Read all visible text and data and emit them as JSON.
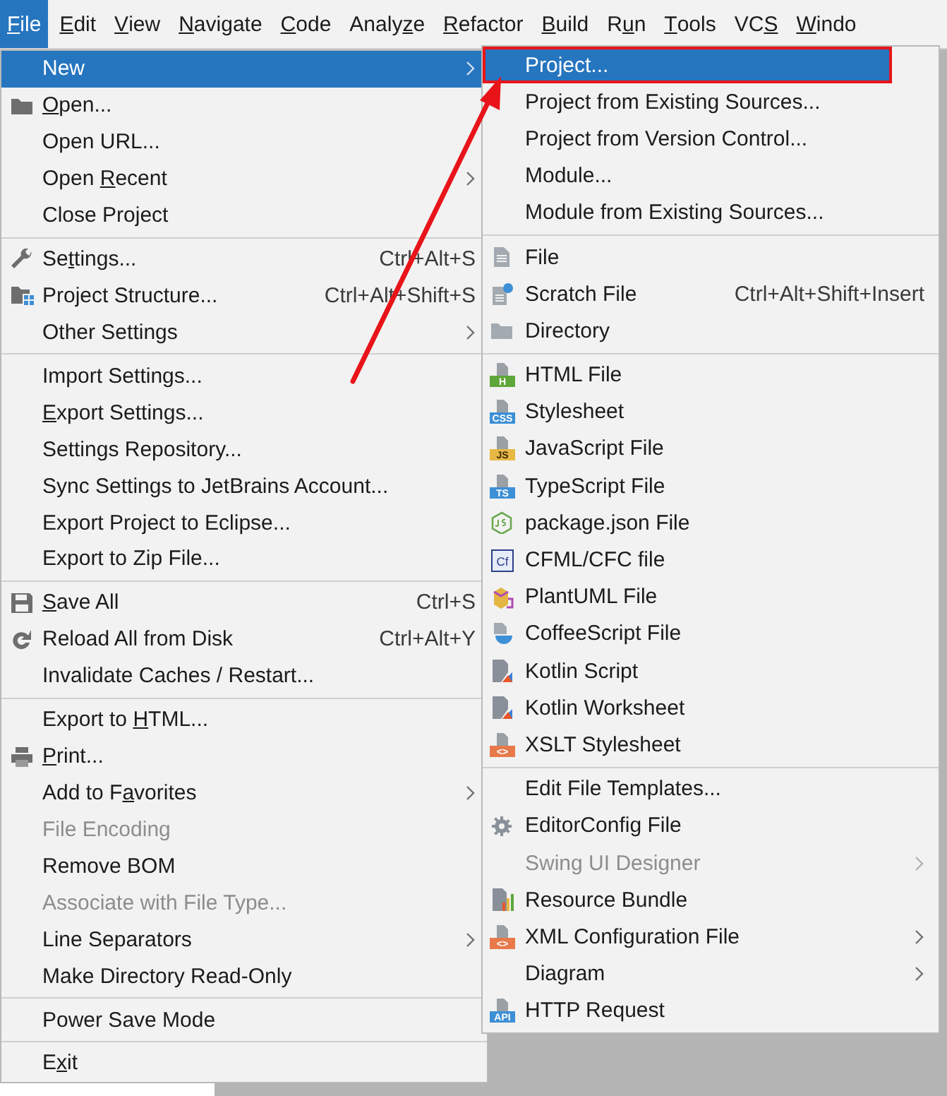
{
  "menubar": [
    {
      "segments": [
        {
          "text": "F",
          "underlined": true
        },
        {
          "text": "ile",
          "underlined": false
        }
      ],
      "selected": true
    },
    {
      "segments": [
        {
          "text": "E",
          "underlined": true
        },
        {
          "text": "dit",
          "underlined": false
        }
      ],
      "selected": false
    },
    {
      "segments": [
        {
          "text": "V",
          "underlined": true
        },
        {
          "text": "iew",
          "underlined": false
        }
      ],
      "selected": false
    },
    {
      "segments": [
        {
          "text": "N",
          "underlined": true
        },
        {
          "text": "avigate",
          "underlined": false
        }
      ],
      "selected": false
    },
    {
      "segments": [
        {
          "text": "C",
          "underlined": true
        },
        {
          "text": "ode",
          "underlined": false
        }
      ],
      "selected": false
    },
    {
      "segments": [
        {
          "text": "Analy",
          "underlined": false
        },
        {
          "text": "z",
          "underlined": true
        },
        {
          "text": "e",
          "underlined": false
        }
      ],
      "selected": false
    },
    {
      "segments": [
        {
          "text": "R",
          "underlined": true
        },
        {
          "text": "efactor",
          "underlined": false
        }
      ],
      "selected": false
    },
    {
      "segments": [
        {
          "text": "B",
          "underlined": true
        },
        {
          "text": "uild",
          "underlined": false
        }
      ],
      "selected": false
    },
    {
      "segments": [
        {
          "text": "R",
          "underlined": false
        },
        {
          "text": "u",
          "underlined": true
        },
        {
          "text": "n",
          "underlined": false
        }
      ],
      "selected": false
    },
    {
      "segments": [
        {
          "text": "T",
          "underlined": true
        },
        {
          "text": "ools",
          "underlined": false
        }
      ],
      "selected": false
    },
    {
      "segments": [
        {
          "text": "VC",
          "underlined": false
        },
        {
          "text": "S",
          "underlined": true
        }
      ],
      "selected": false
    },
    {
      "segments": [
        {
          "text": "W",
          "underlined": true
        },
        {
          "text": "indo",
          "underlined": false
        }
      ],
      "selected": false
    }
  ],
  "file_menu": {
    "groups": [
      {
        "items": [
          {
            "label": "New",
            "selected": true,
            "disabled": false,
            "submenu": true
          },
          {
            "segments": [
              {
                "text": "O",
                "underlined": true
              },
              {
                "text": "pen...",
                "underlined": false
              }
            ],
            "selected": false,
            "disabled": false,
            "submenu": false
          },
          {
            "label": "Open URL...",
            "selected": false,
            "disabled": false,
            "submenu": false
          },
          {
            "segments": [
              {
                "text": "Open ",
                "underlined": false
              },
              {
                "text": "R",
                "underlined": true
              },
              {
                "text": "ecent",
                "underlined": false
              }
            ],
            "selected": false,
            "disabled": false,
            "submenu": true
          },
          {
            "label": "Close Project",
            "selected": false,
            "disabled": false,
            "submenu": false
          }
        ]
      },
      {
        "items": [
          {
            "segments": [
              {
                "text": "Se",
                "underlined": false
              },
              {
                "text": "t",
                "underlined": true
              },
              {
                "text": "tings...",
                "underlined": false
              }
            ],
            "shortcut": "Ctrl+Alt+S",
            "selected": false,
            "disabled": false,
            "submenu": false
          },
          {
            "label": "Project Structure...",
            "shortcut": "Ctrl+Alt+Shift+S",
            "selected": false,
            "disabled": false,
            "submenu": false
          },
          {
            "label": "Other Settings",
            "selected": false,
            "disabled": false,
            "submenu": true
          }
        ]
      },
      {
        "items": [
          {
            "label": "Import Settings...",
            "selected": false,
            "disabled": false,
            "submenu": false
          },
          {
            "segments": [
              {
                "text": "E",
                "underlined": true
              },
              {
                "text": "xport Settings...",
                "underlined": false
              }
            ],
            "selected": false,
            "disabled": false,
            "submenu": false
          },
          {
            "label": "Settings Repository...",
            "selected": false,
            "disabled": false,
            "submenu": false
          },
          {
            "label": "Sync Settings to JetBrains Account...",
            "selected": false,
            "disabled": false,
            "submenu": false
          },
          {
            "label": "Export Project to Eclipse...",
            "selected": false,
            "disabled": false,
            "submenu": false
          },
          {
            "label": "Export to Zip File...",
            "selected": false,
            "disabled": false,
            "submenu": false
          }
        ]
      },
      {
        "items": [
          {
            "segments": [
              {
                "text": "S",
                "underlined": true
              },
              {
                "text": "ave All",
                "underlined": false
              }
            ],
            "shortcut": "Ctrl+S",
            "selected": false,
            "disabled": false,
            "submenu": false
          },
          {
            "label": "Reload All from Disk",
            "shortcut": "Ctrl+Alt+Y",
            "selected": false,
            "disabled": false,
            "submenu": false
          },
          {
            "label": "Invalidate Caches / Restart...",
            "selected": false,
            "disabled": false,
            "submenu": false
          }
        ]
      },
      {
        "items": [
          {
            "segments": [
              {
                "text": "Export to ",
                "underlined": false
              },
              {
                "text": "H",
                "underlined": true
              },
              {
                "text": "TML...",
                "underlined": false
              }
            ],
            "selected": false,
            "disabled": false,
            "submenu": false
          },
          {
            "segments": [
              {
                "text": "P",
                "underlined": true
              },
              {
                "text": "rint...",
                "underlined": false
              }
            ],
            "selected": false,
            "disabled": false,
            "submenu": false
          },
          {
            "segments": [
              {
                "text": "Add to F",
                "underlined": false
              },
              {
                "text": "a",
                "underlined": true
              },
              {
                "text": "vorites",
                "underlined": false
              }
            ],
            "selected": false,
            "disabled": false,
            "submenu": true
          },
          {
            "label": "File Encoding",
            "selected": false,
            "disabled": true,
            "submenu": false
          },
          {
            "label": "Remove BOM",
            "selected": false,
            "disabled": false,
            "submenu": false
          },
          {
            "label": "Associate with File Type...",
            "selected": false,
            "disabled": true,
            "submenu": false
          },
          {
            "label": "Line Separators",
            "selected": false,
            "disabled": false,
            "submenu": true
          },
          {
            "label": "Make Directory Read-Only",
            "selected": false,
            "disabled": false,
            "submenu": false
          }
        ]
      },
      {
        "items": [
          {
            "label": "Power Save Mode",
            "selected": false,
            "disabled": false,
            "submenu": false
          }
        ]
      },
      {
        "items": [
          {
            "segments": [
              {
                "text": "E",
                "underlined": false
              },
              {
                "text": "x",
                "underlined": true
              },
              {
                "text": "it",
                "underlined": false
              }
            ],
            "selected": false,
            "disabled": false,
            "submenu": false
          }
        ]
      }
    ]
  },
  "new_submenu": {
    "groups": [
      {
        "items": [
          {
            "label": "Project...",
            "selected": true,
            "outlined": true,
            "disabled": false,
            "submenu": false
          },
          {
            "label": "Project from Existing Sources...",
            "selected": false,
            "outlined": false,
            "disabled": false,
            "submenu": false
          },
          {
            "label": "Project from Version Control...",
            "selected": false,
            "outlined": false,
            "disabled": false,
            "submenu": false
          },
          {
            "label": "Module...",
            "selected": false,
            "outlined": false,
            "disabled": false,
            "submenu": false
          },
          {
            "label": "Module from Existing Sources...",
            "selected": false,
            "outlined": false,
            "disabled": false,
            "submenu": false
          }
        ]
      },
      {
        "items": [
          {
            "label": "File",
            "selected": false,
            "outlined": false,
            "disabled": false,
            "submenu": false
          },
          {
            "label": "Scratch File",
            "shortcut": "Ctrl+Alt+Shift+Insert",
            "selected": false,
            "outlined": false,
            "disabled": false,
            "submenu": false
          },
          {
            "label": "Directory",
            "selected": false,
            "outlined": false,
            "disabled": false,
            "submenu": false
          }
        ]
      },
      {
        "items": [
          {
            "label": "HTML File",
            "badge": "H",
            "color": "#5fa63a",
            "selected": false,
            "outlined": false,
            "disabled": false,
            "submenu": false
          },
          {
            "label": "Stylesheet",
            "badge": "CSS",
            "color": "#3d8fd6",
            "selected": false,
            "outlined": false,
            "disabled": false,
            "submenu": false
          },
          {
            "label": "JavaScript File",
            "badge": "JS",
            "color": "#e8b845",
            "selected": false,
            "outlined": false,
            "disabled": false,
            "submenu": false
          },
          {
            "label": "TypeScript File",
            "badge": "TS",
            "color": "#3d8fd6",
            "selected": false,
            "outlined": false,
            "disabled": false,
            "submenu": false
          },
          {
            "label": "package.json File",
            "selected": false,
            "outlined": false,
            "disabled": false,
            "submenu": false
          },
          {
            "label": "CFML/CFC file",
            "badge": "Cf",
            "color": "#2b3f8c",
            "selected": false,
            "outlined": false,
            "disabled": false,
            "submenu": false
          },
          {
            "label": "PlantUML File",
            "selected": false,
            "outlined": false,
            "disabled": false,
            "submenu": false
          },
          {
            "label": "CoffeeScript File",
            "selected": false,
            "outlined": false,
            "disabled": false,
            "submenu": false
          },
          {
            "label": "Kotlin Script",
            "selected": false,
            "outlined": false,
            "disabled": false,
            "submenu": false
          },
          {
            "label": "Kotlin Worksheet",
            "selected": false,
            "outlined": false,
            "disabled": false,
            "submenu": false
          },
          {
            "label": "XSLT Stylesheet",
            "badge": "<>",
            "color": "#e8794a",
            "selected": false,
            "outlined": false,
            "disabled": false,
            "submenu": false
          }
        ]
      },
      {
        "items": [
          {
            "label": "Edit File Templates...",
            "selected": false,
            "outlined": false,
            "disabled": false,
            "submenu": false
          },
          {
            "label": "EditorConfig File",
            "selected": false,
            "outlined": false,
            "disabled": false,
            "submenu": false
          },
          {
            "label": "Swing UI Designer",
            "selected": false,
            "outlined": false,
            "disabled": true,
            "submenu": true
          },
          {
            "label": "Resource Bundle",
            "selected": false,
            "outlined": false,
            "disabled": false,
            "submenu": false
          },
          {
            "label": "XML Configuration File",
            "badge": "<>",
            "color": "#e8794a",
            "selected": false,
            "outlined": false,
            "disabled": false,
            "submenu": true
          },
          {
            "label": "Diagram",
            "selected": false,
            "outlined": false,
            "disabled": false,
            "submenu": true
          },
          {
            "label": "HTTP Request",
            "badge": "API",
            "color": "#3d8fd6",
            "selected": false,
            "outlined": false,
            "disabled": false,
            "submenu": false
          }
        ]
      }
    ]
  }
}
